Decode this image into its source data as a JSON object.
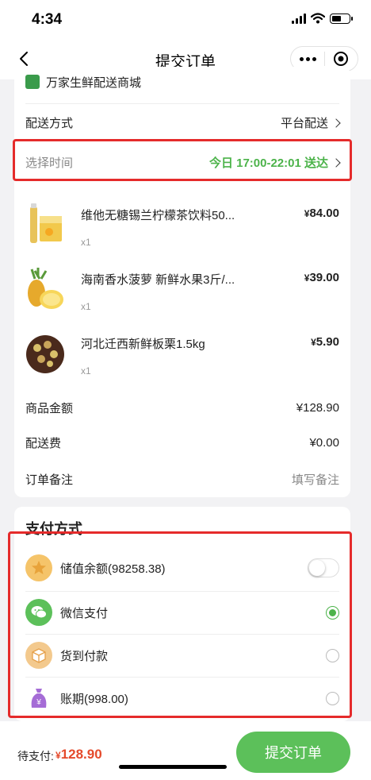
{
  "status_bar": {
    "time": "4:34",
    "battery_level": 0.6
  },
  "nav": {
    "title": "提交订单"
  },
  "store": {
    "name": "万家生鲜配送商城"
  },
  "delivery": {
    "method_label": "配送方式",
    "method_value": "平台配送",
    "time_label": "选择时间",
    "time_value": "今日 17:00-22:01 送达"
  },
  "products": [
    {
      "name": "维他无糖锡兰柠檬茶饮料50...",
      "qty": "x1",
      "currency": "¥",
      "price": "84.00"
    },
    {
      "name": "海南香水菠萝 新鲜水果3斤/...",
      "qty": "x1",
      "currency": "¥",
      "price": "39.00"
    },
    {
      "name": "河北迁西新鲜板栗1.5kg",
      "qty": "x1",
      "currency": "¥",
      "price": "5.90"
    }
  ],
  "summary": {
    "goods_label": "商品金额",
    "goods_value": "¥128.90",
    "shipping_label": "配送费",
    "shipping_value": "¥0.00",
    "remark_label": "订单备注",
    "remark_placeholder": "填写备注"
  },
  "payment": {
    "title": "支付方式",
    "options": [
      {
        "label": "储值余额(98258.38)",
        "icon": "star-coin-icon",
        "control": "toggle",
        "selected": false
      },
      {
        "label": "微信支付",
        "icon": "wechat-icon",
        "control": "radio",
        "selected": true
      },
      {
        "label": "货到付款",
        "icon": "box-icon",
        "control": "radio",
        "selected": false
      },
      {
        "label": "账期(998.00)",
        "icon": "yen-bag-icon",
        "control": "radio",
        "selected": false
      }
    ]
  },
  "bottom": {
    "due_label": "待支付:",
    "due_currency": "¥",
    "due_amount": "128.90",
    "submit_label": "提交订单"
  },
  "colors": {
    "accent_green": "#4cb34a",
    "button_green": "#5cc05a",
    "highlight_red": "#e52b2b",
    "price_red": "#e54a2b"
  }
}
